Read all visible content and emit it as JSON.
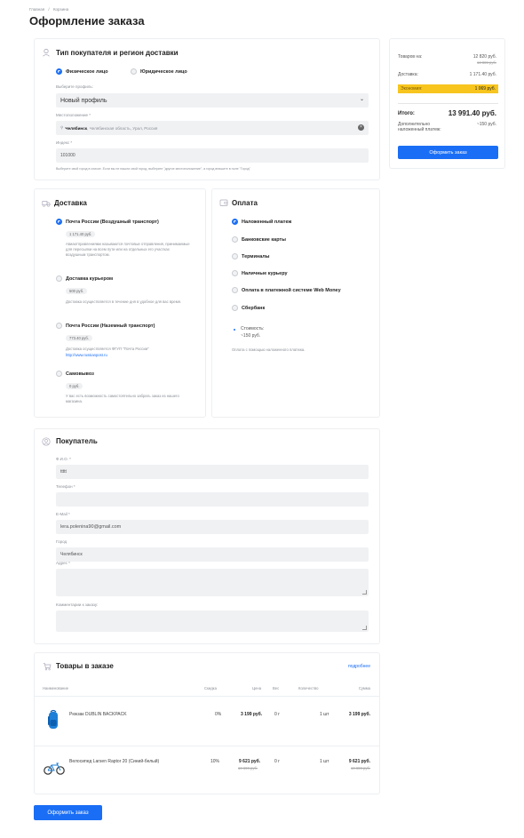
{
  "breadcrumb": [
    "Главная",
    "/",
    "Корзина"
  ],
  "page_title": "Оформление заказа",
  "buyer_type": {
    "title": "Тип покупателя и регион доставки",
    "options": [
      "Физическое лицо",
      "Юридическое лицо"
    ],
    "profile_label": "Выберите профиль:",
    "profile_value": "Новый профиль",
    "location_label": "Местоположение *",
    "location_city": "Челябинск",
    "location_rest": ", Челябинская область, Урал, Россия",
    "index_label": "Индекс *",
    "index_value": "101000",
    "hint": "Выберите свой город в списке. Если вы не нашли свой город, выберите \"другое местоположение\", а город впишите в поле \"Город\""
  },
  "delivery": {
    "title": "Доставка",
    "options": [
      {
        "label": "Почта России (Воздушный транспорт)",
        "price": "1 171.40 руб.",
        "desc": "Авиаотправлениями называются почтовые отправления, принимаемые для пересылки на всем пути или на отдельных его участках воздушным транспортом."
      },
      {
        "label": "Доставка курьером",
        "price": "500 руб.",
        "desc": "Доставка осуществляется в течение дня в удобное для вас время."
      },
      {
        "label": "Почта России (Наземный транспорт)",
        "price": "773.40 руб.",
        "desc": "Доставка осуществляется ФГУП \"Почта России\"",
        "link": "http://www.russianpost.ru"
      },
      {
        "label": "Самовывоз",
        "price": "0 руб.",
        "desc": "У вас есть возможность самостоятельно забрать заказ из нашего магазина."
      }
    ]
  },
  "payment": {
    "title": "Оплата",
    "options": [
      "Наложенный платеж",
      "Банковские карты",
      "Терминалы",
      "Наличные курьеру",
      "Оплата в платежной системе Web Money",
      "Сбербанк"
    ],
    "cost_label": "Стоимость:",
    "cost_value": "~150 руб.",
    "note": "Оплата с помощью наложенного платежа."
  },
  "customer": {
    "title": "Покупатель",
    "fio_label": "Ф.И.О. *",
    "fio_value": "ttttt",
    "phone_label": "Телефон *",
    "email_label": "E-Mail *",
    "email_value": "lera.polenina90@gmail.com",
    "city_label": "Город",
    "city_value": "Челябинск",
    "address_label": "Адрес *",
    "comment_label": "Комментарии к заказу:"
  },
  "goods": {
    "title": "Товары в заказе",
    "more": "подробнее",
    "headers": [
      "Наименование",
      "Скидка",
      "Цена",
      "Вес",
      "Количество",
      "Сумма"
    ],
    "items": [
      {
        "name": "Рюкзак DUBLIN BACKPACK",
        "discount": "0%",
        "price": "3 199 руб.",
        "old_price": "",
        "weight": "0 г",
        "qty": "1 шт",
        "sum": "3 199 руб.",
        "old_sum": ""
      },
      {
        "name": "Велосипед Larsen Raptor 20 (Синий-белый)",
        "discount": "10%",
        "price": "9 621 руб.",
        "old_price": "10 690 руб.",
        "weight": "0 г",
        "qty": "1 шт",
        "sum": "9 621 руб.",
        "old_sum": "10 690 руб."
      }
    ]
  },
  "summary": {
    "goods_label": "Товаров на:",
    "goods_value": "12 820 руб.",
    "goods_old": "13 889 руб.",
    "delivery_label": "Доставка:",
    "delivery_value": "1 171.40 руб.",
    "economy_label": "Экономия:",
    "economy_value": "1 069 руб.",
    "total_label": "Итого:",
    "total_value": "13 991.40 руб.",
    "extra_label": "Дополнительно наложенный платеж:",
    "extra_value": "~150 руб.",
    "button": "Оформить заказ"
  },
  "bottom_button": "Оформить заказ",
  "colors": {
    "accent": "#1a6ef5",
    "economy": "#f7c51e"
  }
}
